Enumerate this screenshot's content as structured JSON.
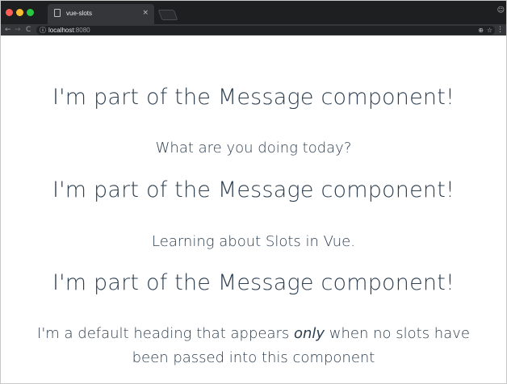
{
  "browser": {
    "tab_title": "vue-slots",
    "tab_close": "×",
    "url_host": "localhost",
    "url_port": ":8080"
  },
  "page": {
    "heading": "I'm part of the Message component!",
    "messages": [
      "What are you doing today?",
      "Learning about Slots in Vue."
    ],
    "default_before": "I'm a default heading that appears ",
    "default_emphasis": "only",
    "default_after": " when no slots have been passed into this component"
  },
  "colors": {
    "text": "#2c3e50",
    "chrome_dark": "#1e1f21",
    "toolbar": "#35363a"
  },
  "icons": [
    "page-icon",
    "close-icon",
    "back-arrow-icon",
    "forward-arrow-icon",
    "reload-icon",
    "info-icon",
    "zoom-icon",
    "star-icon",
    "menu-icon",
    "profile-icon"
  ]
}
